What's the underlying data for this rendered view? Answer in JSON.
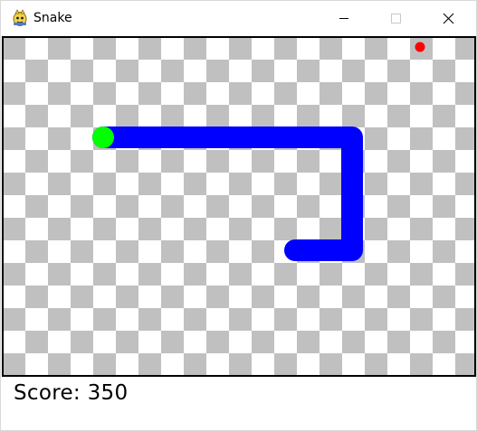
{
  "window": {
    "title": "Snake",
    "icon": "pygame-snake-icon",
    "controls": {
      "minimize_icon": "minimize-icon",
      "maximize_icon": "maximize-icon",
      "close_icon": "close-icon"
    }
  },
  "game": {
    "score_text": "Score: 350",
    "colors": {
      "snake_body": "#0000ff",
      "snake_head": "#00ff00",
      "food": "#ff0000",
      "checker_dark": "#c0c0c0",
      "checker_light": "#ffffff",
      "border": "#000000"
    }
  }
}
